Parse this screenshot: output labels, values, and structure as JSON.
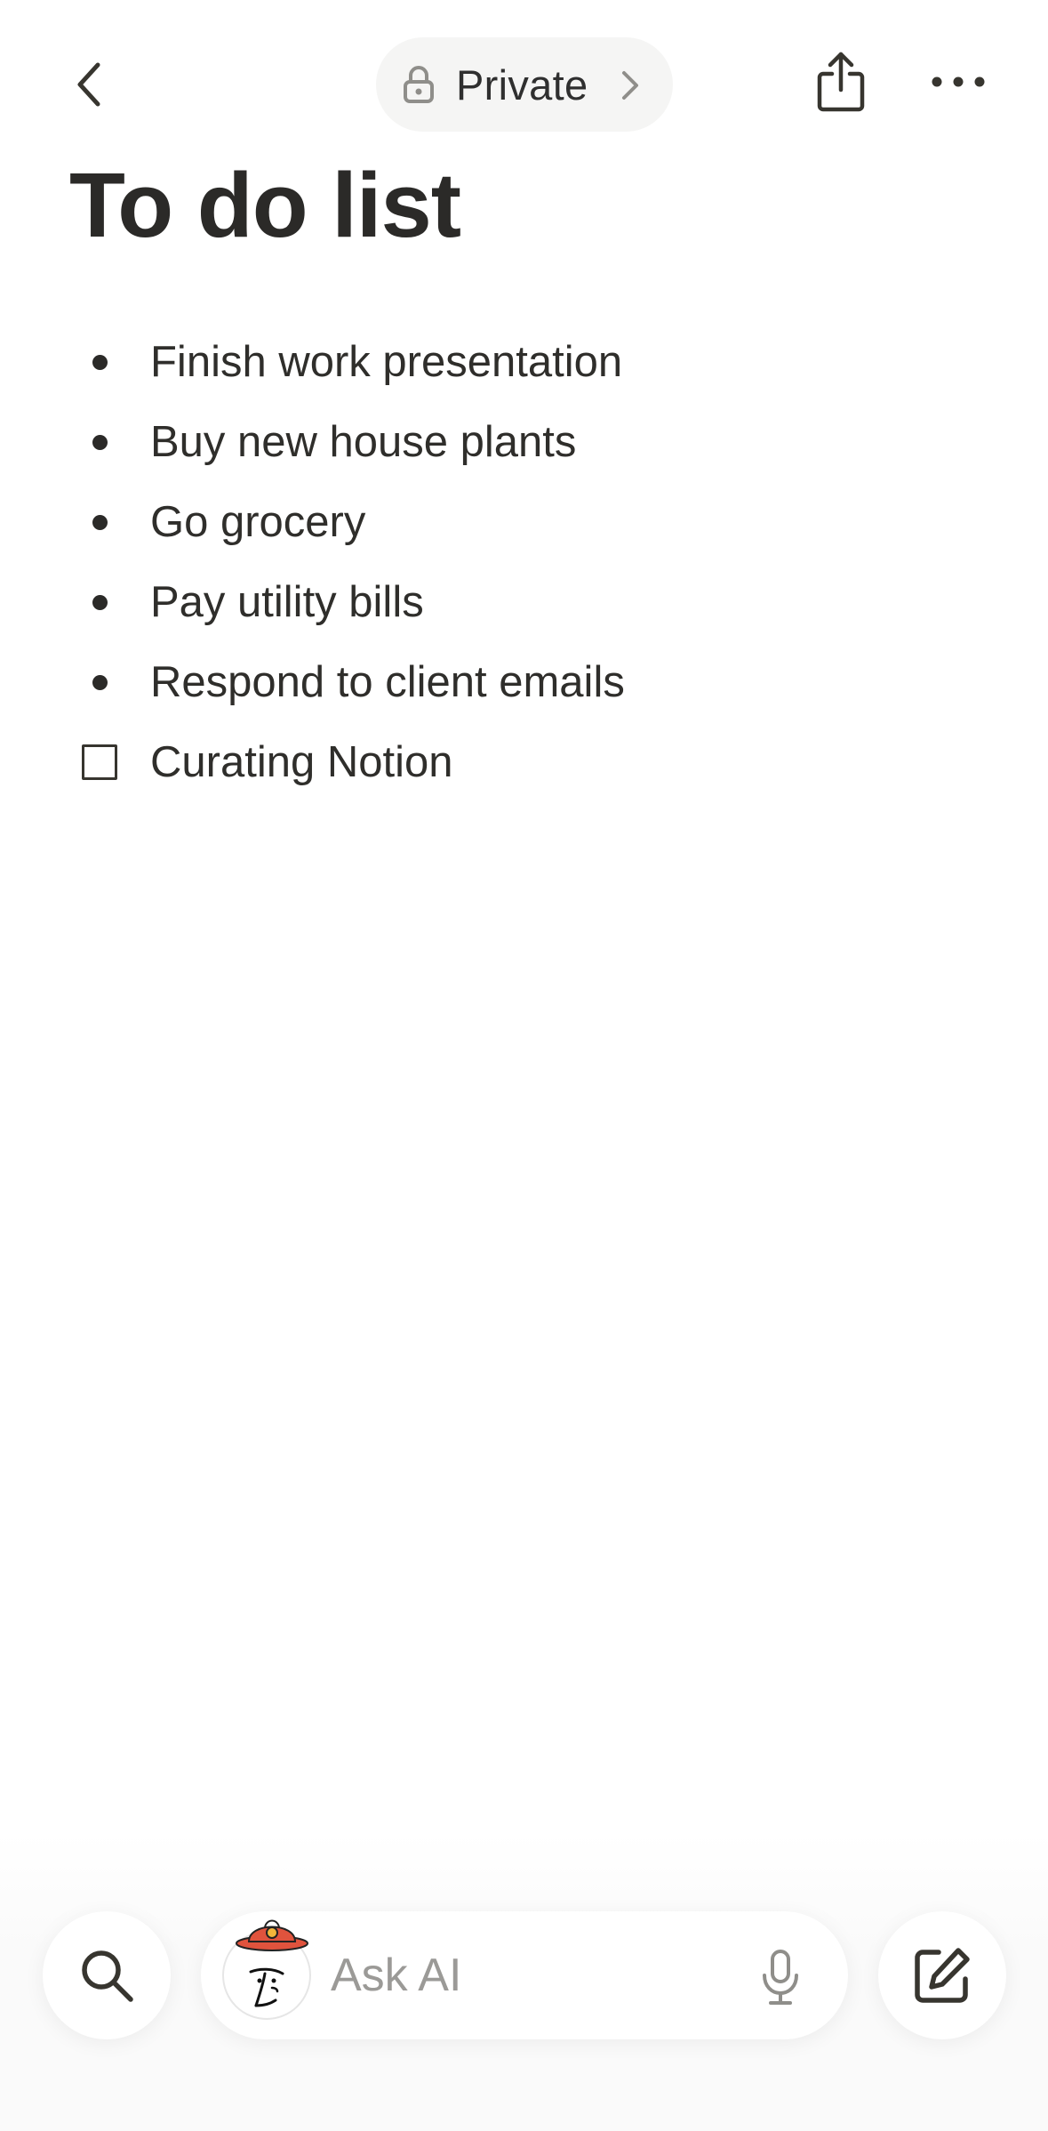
{
  "header": {
    "privacy_label": "Private",
    "icons": {
      "back": "chevron-left-icon",
      "lock": "lock-icon",
      "privacy_chevron": "chevron-right-icon",
      "share": "share-icon",
      "more": "more-horizontal-icon"
    }
  },
  "page": {
    "title": "To do list",
    "items": [
      {
        "type": "bullet",
        "text": "Finish work presentation"
      },
      {
        "type": "bullet",
        "text": "Buy new house plants"
      },
      {
        "type": "bullet",
        "text": "Go grocery"
      },
      {
        "type": "bullet",
        "text": "Pay utility bills"
      },
      {
        "type": "bullet",
        "text": "Respond to client emails"
      },
      {
        "type": "todo",
        "text": "Curating Notion",
        "checked": false
      }
    ]
  },
  "bottom_bar": {
    "ask_placeholder": "Ask AI",
    "icons": {
      "search": "search-icon",
      "ai_avatar": "notion-ai-face-icon",
      "mic": "microphone-icon",
      "compose": "compose-icon"
    }
  },
  "colors": {
    "text": "#37352f",
    "pill_bg": "#f5f5f4",
    "placeholder": "#9b9a97",
    "hat_red": "#e0533d"
  }
}
